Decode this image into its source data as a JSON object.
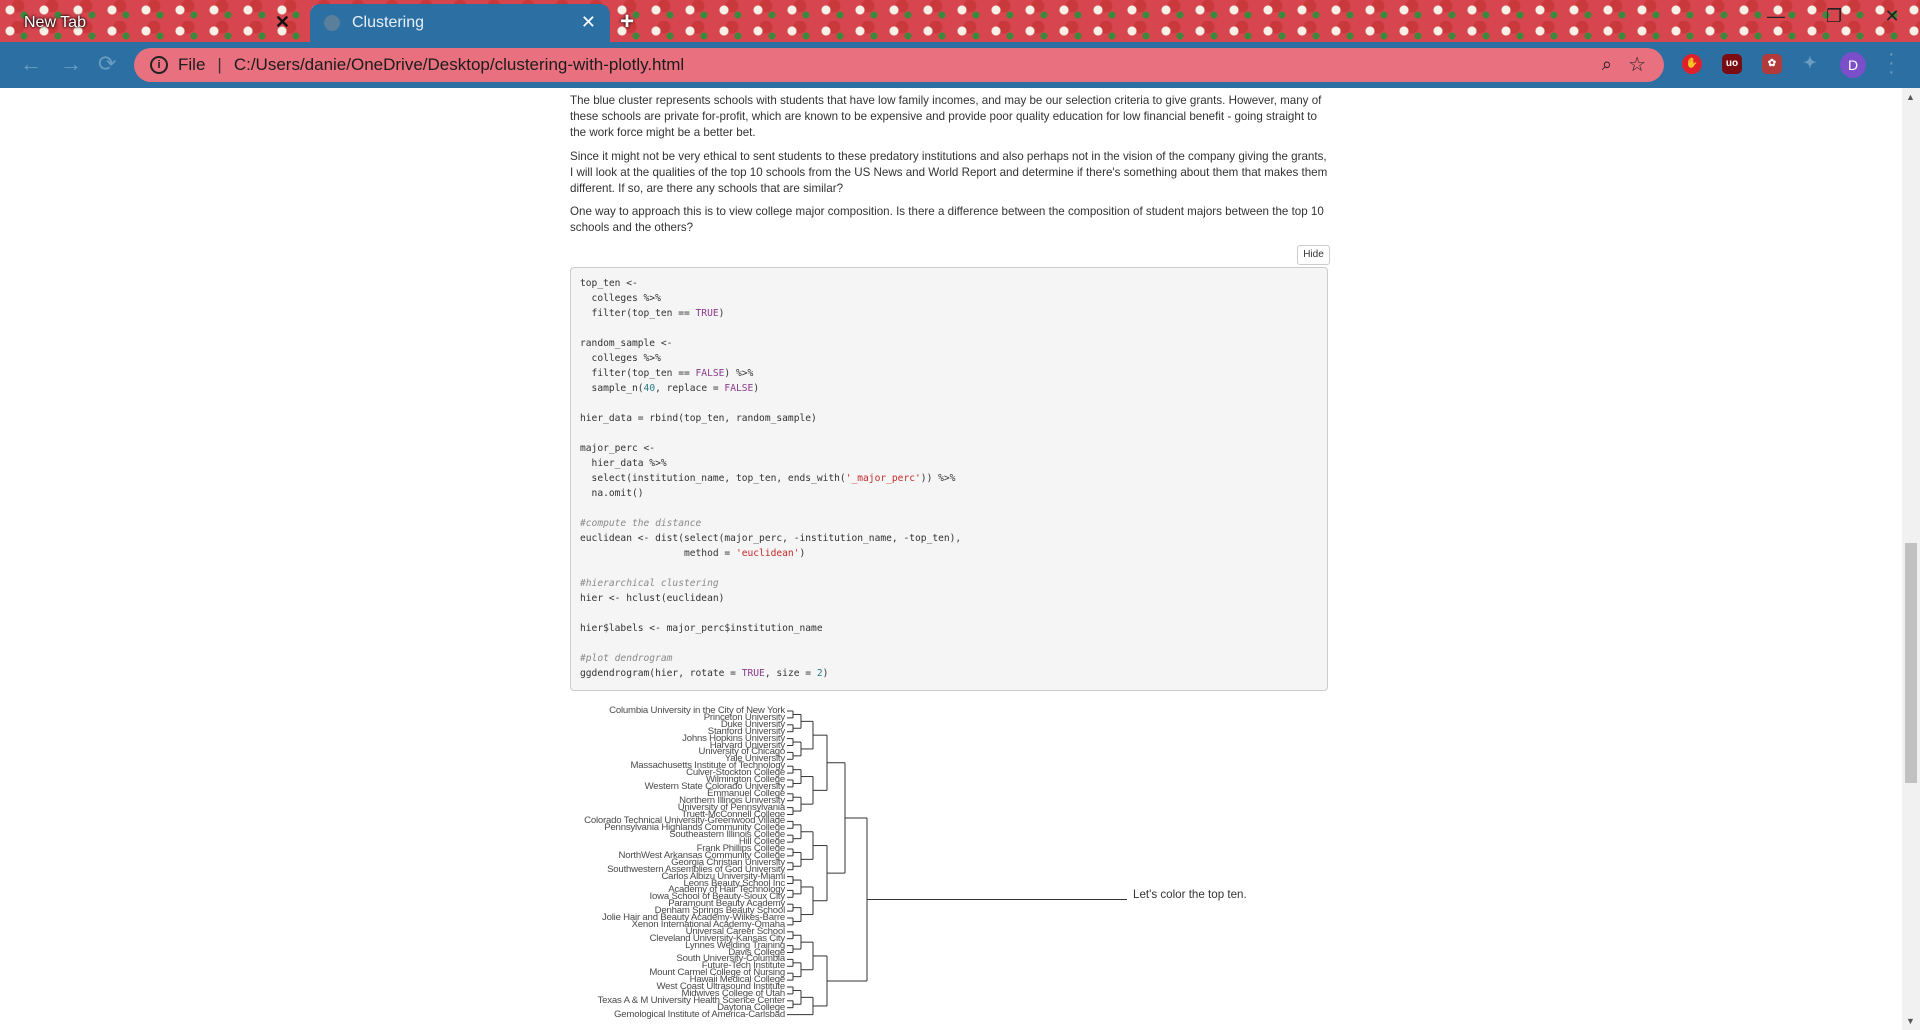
{
  "browser": {
    "tabs": [
      {
        "title": "New Tab",
        "active": false
      },
      {
        "title": "Clustering",
        "active": true
      }
    ],
    "address": {
      "scheme": "File",
      "path": "C:/Users/danie/OneDrive/Desktop/clustering-with-plotly.html"
    },
    "profile_initial": "D",
    "extension_badge": "uo",
    "colors": {
      "toolbar": "#2b6fa3",
      "omnibox": "#e8707f",
      "theme": "#d7464f"
    }
  },
  "page": {
    "paragraphs": [
      "The blue cluster represents schools with students that have low family incomes, and may be our selection criteria to give grants. However, many of these schools are private for-profit, which are known to be expensive and provide poor quality education for low financial benefit - going straight to the work force might be a better bet.",
      "Since it might not be very ethical to sent students to these predatory institutions and also perhaps not in the vision of the company giving the grants, I will look at the qualities of the top 10 schools from the US News and World Report and determine if there's something about them that makes them different. If so, are there any schools that are similar?",
      "One way to approach this is to view college major composition. Is there a difference between the composition of student majors between the top 10 schools and the others?"
    ],
    "hide_button": "Hide",
    "code": {
      "l01": "top_ten <-",
      "l02": "  colleges %>%",
      "l03a": "  filter(top_ten == ",
      "l03b": "TRUE",
      "l03c": ")",
      "l05": "random_sample <-",
      "l06": "  colleges %>%",
      "l07a": "  filter(top_ten == ",
      "l07b": "FALSE",
      "l07c": ") %>%",
      "l08a": "  sample_n(",
      "l08b": "40",
      "l08c": ", replace = ",
      "l08d": "FALSE",
      "l08e": ")",
      "l10": "hier_data = rbind(top_ten, random_sample)",
      "l12": "major_perc <-",
      "l13": "  hier_data %>%",
      "l14a": "  select(institution_name, top_ten, ends_with(",
      "l14b": "'_major_perc'",
      "l14c": ")) %>%",
      "l15": "  na.omit()",
      "l17": "#compute the distance",
      "l18": "euclidean <- dist(select(major_perc, -institution_name, -top_ten),",
      "l19a": "                  method = ",
      "l19b": "'euclidean'",
      "l19c": ")",
      "l21": "#hierarchical clustering",
      "l22": "hier <- hclust(euclidean)",
      "l24": "hier$labels <- major_perc$institution_name",
      "l26": "#plot dendrogram",
      "l27a": "ggdendrogram(hier, rotate = ",
      "l27b": "TRUE",
      "l27c": ", size = ",
      "l27d": "2",
      "l27e": ")"
    },
    "dendrogram_labels": [
      "Columbia University in the City of New York",
      "Princeton University",
      "Duke University",
      "Stanford University",
      "Johns Hopkins University",
      "Harvard University",
      "University of Chicago",
      "Yale University",
      "Massachusetts Institute of Technology",
      "Culver-Stockton College",
      "Wilmington College",
      "Western State Colorado University",
      "Emmanuel College",
      "Northern Illinois University",
      "University of Pennsylvania",
      "Truett-McConnell College",
      "Colorado Technical University-Greenwood Village",
      "Pennsylvania Highlands Community College",
      "Southeastern Illinois College",
      "Hill College",
      "Frank Phillips College",
      "NorthWest Arkansas Community College",
      "Georgia Christian University",
      "Southwestern Assemblies of God University",
      "Carlos Albizu University-Miami",
      "Leons Beauty School Inc",
      "Academy of Hair Technology",
      "Iowa School of Beauty-Sioux City",
      "Paramount Beauty Academy",
      "Denham Springs Beauty School",
      "Jolie Hair and Beauty Academy-Wilkes-Barre",
      "Xenon International Academy-Omaha",
      "Universal Career School",
      "Cleveland University-Kansas City",
      "Lynnes Welding Training",
      "Davis College",
      "South University-Columbia",
      "Future-Tech Institute",
      "Mount Carmel College of Nursing",
      "Hawaii Medical College",
      "West Coast Ultrasound Institute",
      "Midwives College of Utah",
      "Texas A & M University Health Science Center",
      "Daytona College",
      "Gemological Institute of America-Carlsbad"
    ],
    "side_note": "Let's color the top ten."
  }
}
